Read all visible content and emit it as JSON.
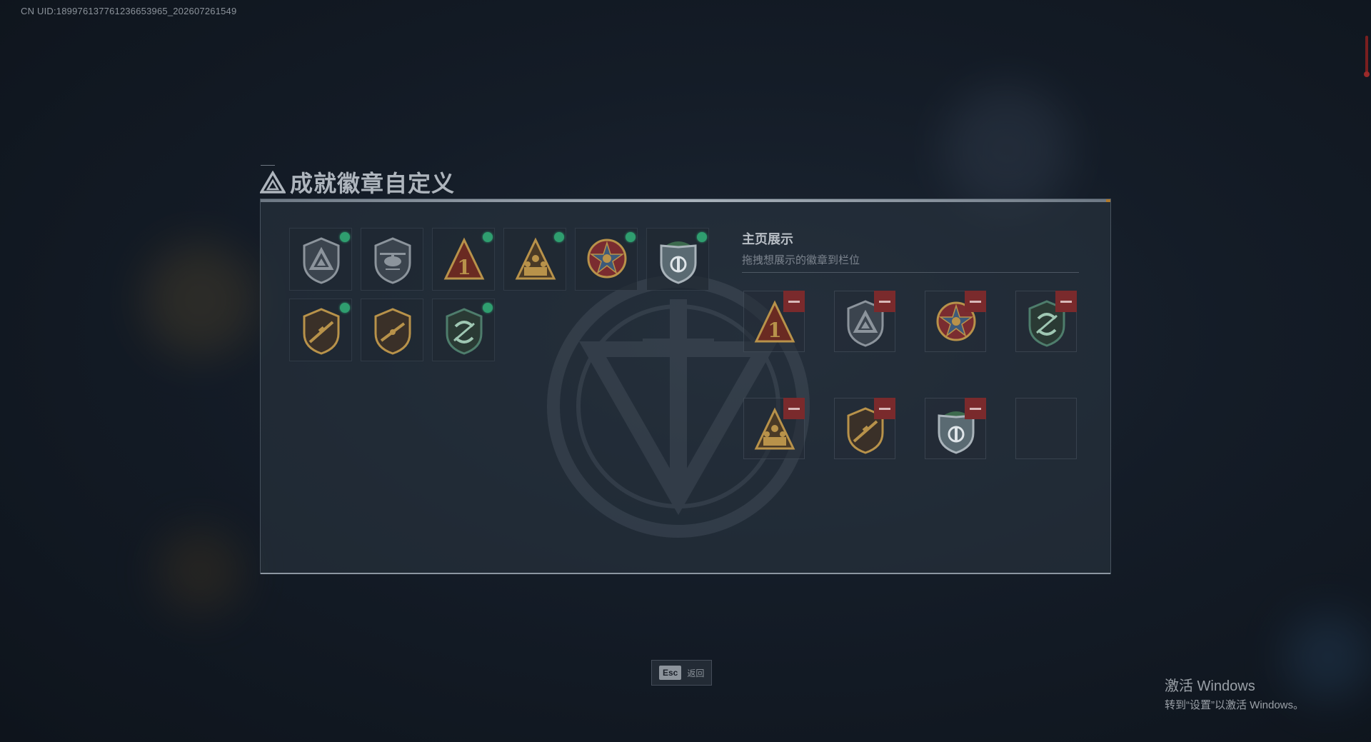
{
  "uid_text": "CN UID:1899761377612366539​65_202607261549",
  "title": "成就徽章自定义",
  "showcase": {
    "title": "主页展示",
    "subtitle": "拖拽想展示的徽章到栏位"
  },
  "badges": [
    {
      "icon": "triangle-shield-icon",
      "selected": true
    },
    {
      "icon": "helicopter-shield-icon",
      "selected": false
    },
    {
      "icon": "number-one-triangle-icon",
      "selected": true
    },
    {
      "icon": "squad-triangle-icon",
      "selected": true
    },
    {
      "icon": "star-emblem-icon",
      "selected": true
    },
    {
      "icon": "green-helmet-shield-icon",
      "selected": true
    },
    {
      "icon": "rifle-shield-icon",
      "selected": true
    },
    {
      "icon": "rifle-shield-alt-icon",
      "selected": false
    },
    {
      "icon": "green-arrows-shield-icon",
      "selected": true
    }
  ],
  "display_slots": [
    {
      "icon": "number-one-triangle-icon"
    },
    {
      "icon": "triangle-shield-icon"
    },
    {
      "icon": "star-emblem-icon"
    },
    {
      "icon": "green-arrows-shield-icon"
    },
    {
      "icon": "squad-triangle-icon"
    },
    {
      "icon": "rifle-shield-icon"
    },
    {
      "icon": "green-helmet-shield-icon"
    },
    {
      "icon": ""
    }
  ],
  "footer": {
    "key": "Esc",
    "label": "返回"
  },
  "windows_watermark": {
    "line1": "激活 Windows",
    "line2": "转到“设置”以激活 Windows。"
  },
  "colors": {
    "accent_green": "#2f9e6f",
    "remove_red": "#7a2a2c",
    "gold": "#b8924a"
  }
}
